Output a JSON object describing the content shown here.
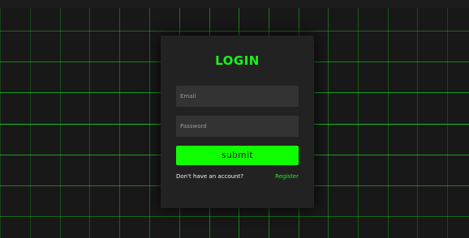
{
  "login": {
    "title": "LOGIN",
    "email_placeholder": "Email",
    "password_placeholder": "Password",
    "submit_label": "submit",
    "no_account_text": "Don't have an account?",
    "register_link": "Register"
  },
  "colors": {
    "accent": "#19f51a",
    "button": "#10ff00",
    "grid_line": "#1ed81e",
    "card": "#222222",
    "input": "#333333",
    "background": "#181818"
  }
}
